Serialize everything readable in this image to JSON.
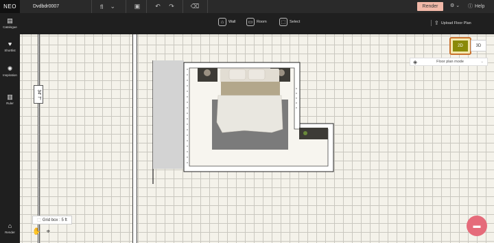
{
  "app": {
    "logo": "NEO",
    "project_name": "Dvdbdr0007",
    "floor_label": "fl"
  },
  "header": {
    "render_label": "Render",
    "help_label": "Help"
  },
  "tools": {
    "wall": "Wall",
    "room": "Room",
    "select": "Select",
    "upload": "Upload Floor Plan"
  },
  "sidebar": {
    "items": [
      {
        "label": "Catalogue",
        "icon": "catalogue-icon"
      },
      {
        "label": "Shortlist",
        "icon": "shortlist-icon"
      },
      {
        "label": "Inspiration",
        "icon": "inspiration-icon"
      },
      {
        "label": "Ruler",
        "icon": "ruler-icon"
      },
      {
        "label": "Render",
        "icon": "render-icon"
      }
    ]
  },
  "view": {
    "btn_2d": "2D",
    "btn_3d": "3D",
    "mode": "Floor plan mode"
  },
  "canvas": {
    "dimension": "34' 7\"",
    "grid_box": "Grid box : 5 ft"
  },
  "colors": {
    "accent": "#f1b8a8",
    "active_2d": "#8a8a08",
    "highlight": "#c9702c",
    "chat": "#e56b7a"
  }
}
